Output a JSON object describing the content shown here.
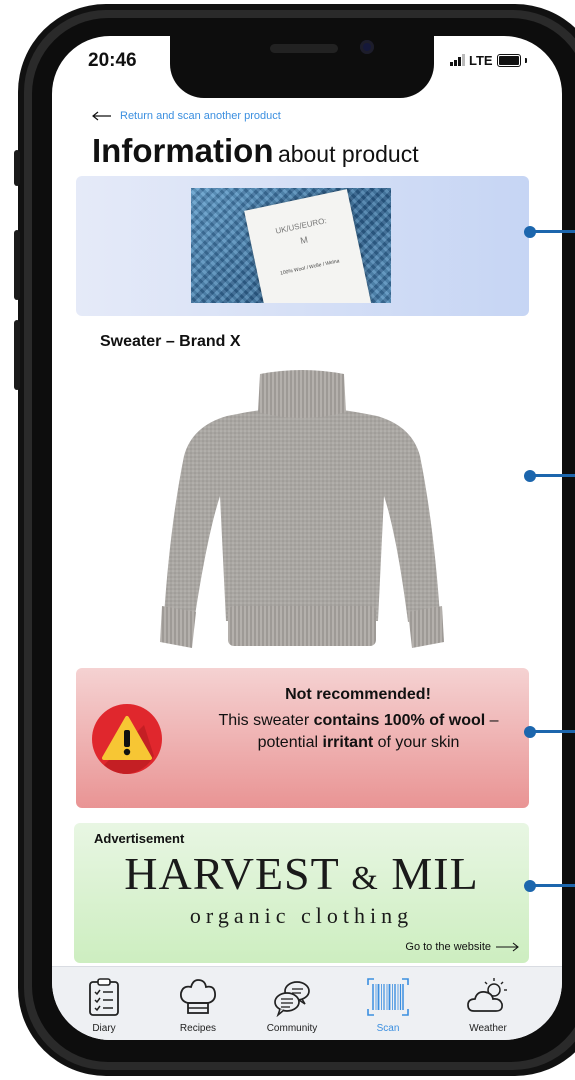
{
  "status": {
    "time": "20:46",
    "network": "LTE"
  },
  "nav": {
    "back_label": "Return and scan another product"
  },
  "page": {
    "title_bold": "Information",
    "title_rest": "about product"
  },
  "label_photo": {
    "size_line": "UK/US/EURO:",
    "size": "M",
    "fiber": "100% Wool / Wolle / Welna"
  },
  "product": {
    "name": "Sweater – Brand X"
  },
  "warning": {
    "title": "Not recommended!",
    "text_1": "This sweater ",
    "bold_1": "contains 100% of wool",
    "text_2": " – potential ",
    "bold_2": "irritant",
    "text_3": " of your skin",
    "color": "#e99494"
  },
  "ad": {
    "label": "Advertisement",
    "brand_1": "HARVEST",
    "brand_amp": "&",
    "brand_2": "MIL",
    "tagline": "organic clothing",
    "link": "Go to the website",
    "color": "#cdeec0"
  },
  "tabs": [
    {
      "label": "Diary",
      "icon": "clipboard-icon"
    },
    {
      "label": "Recipes",
      "icon": "chef-hat-icon"
    },
    {
      "label": "Community",
      "icon": "chat-bubbles-icon"
    },
    {
      "label": "Scan",
      "icon": "barcode-icon",
      "active": true
    },
    {
      "label": "Weather",
      "icon": "sun-cloud-icon"
    }
  ],
  "colors": {
    "accent": "#3b8fe0",
    "callout": "#1c66ad"
  }
}
